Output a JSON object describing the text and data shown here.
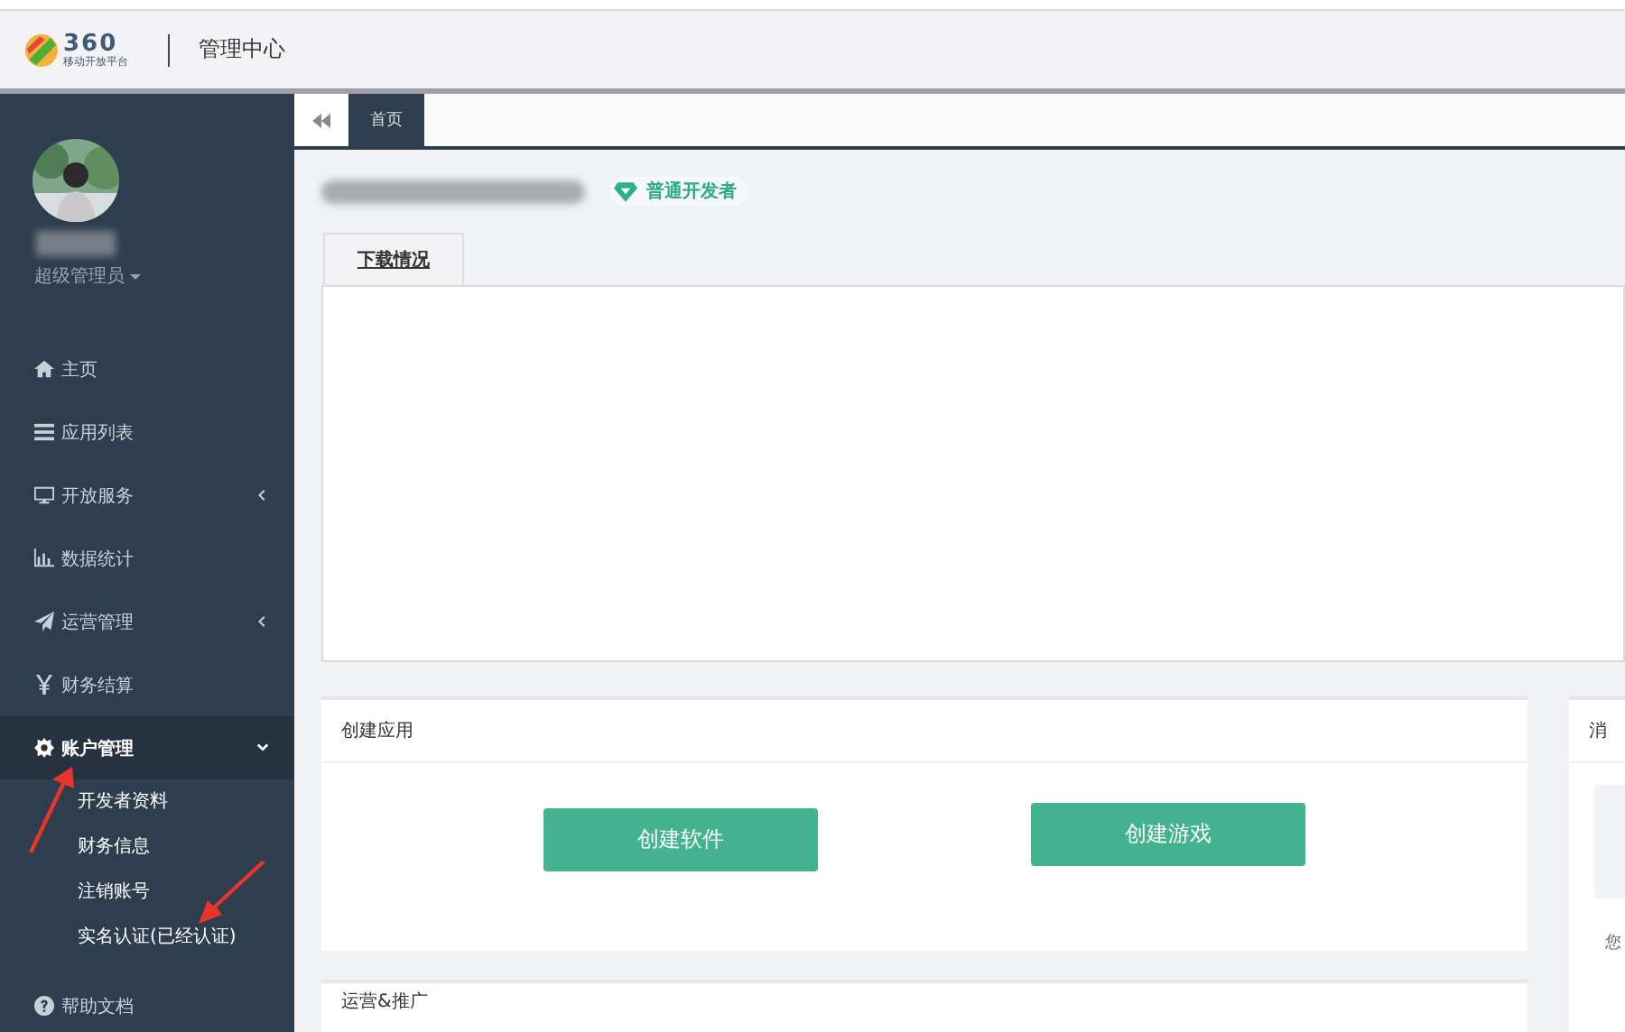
{
  "header": {
    "logo_number": "360",
    "logo_caption": "移动开放平台",
    "title": "管理中心"
  },
  "sidebar": {
    "role": "超级管理员",
    "items": [
      {
        "label": "主页",
        "selected": false
      },
      {
        "label": "应用列表",
        "selected": false
      },
      {
        "label": "开放服务",
        "selected": false,
        "expanded": false
      },
      {
        "label": "数据统计",
        "selected": false
      },
      {
        "label": "运营管理",
        "selected": false,
        "expanded": false
      },
      {
        "label": "财务结算",
        "selected": false
      },
      {
        "label": "账户管理",
        "selected": true,
        "expanded": true,
        "children": [
          {
            "label": "开发者资料"
          },
          {
            "label": "财务信息"
          },
          {
            "label": "注销账号"
          },
          {
            "label": "实名认证(已经认证)"
          }
        ]
      },
      {
        "label": "帮助文档",
        "selected": false
      }
    ]
  },
  "page_tabs": [
    {
      "label": "首页",
      "selected": true
    }
  ],
  "developer_badge": "普通开发者",
  "panel_tabs": [
    {
      "label": "下载情况",
      "selected": true
    }
  ],
  "cards": [
    {
      "title": "创建应用",
      "buttons": [
        "创建软件",
        "创建游戏"
      ]
    },
    {
      "title": "运营&推广"
    }
  ],
  "side_card": {
    "title": "消",
    "text": "您"
  }
}
